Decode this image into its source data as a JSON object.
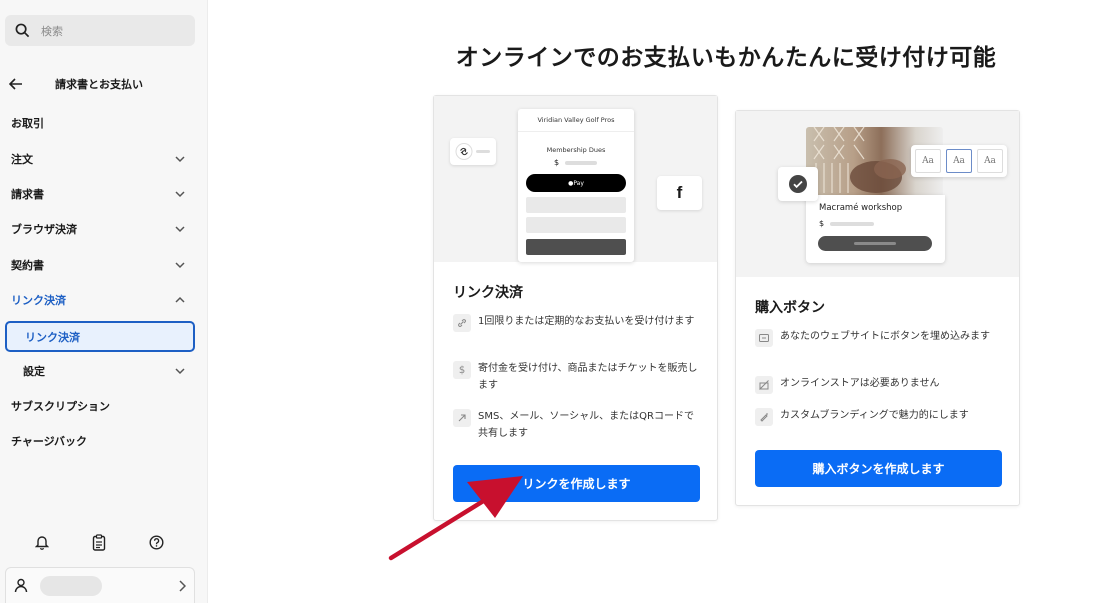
{
  "sidebar": {
    "search_placeholder": "検索",
    "section_title": "請求書とお支払い",
    "items": [
      {
        "label": "お取引"
      },
      {
        "label": "注文"
      },
      {
        "label": "請求書"
      },
      {
        "label": "ブラウザ決済"
      },
      {
        "label": "契約書"
      },
      {
        "label": "リンク決済"
      },
      {
        "label": "リンク決済"
      },
      {
        "label": "設定"
      },
      {
        "label": "サブスクリプション"
      },
      {
        "label": "チャージバック"
      }
    ]
  },
  "main": {
    "title": "オンラインでのお支払いもかんたんに受け付け可能",
    "link_card": {
      "phone_merchant": "Viridian Valley Golf Pros",
      "phone_item": "Membership Dues",
      "phone_currency": "$",
      "phone_pay": " Pay",
      "social_glyph": "f",
      "title": "リンク決済",
      "features": [
        "1回限りまたは定期的なお支払いを受け付けます",
        "寄付金を受け付け、商品またはチケットを販売します",
        "SMS、メール、ソーシャル、またはQRコードで共有します"
      ],
      "cta": "リンクを作成します"
    },
    "button_card": {
      "workshop": "Macramé workshop",
      "currency": "$",
      "font_samples": [
        "Aa",
        "Aa",
        "Aa"
      ],
      "title": "購入ボタン",
      "features": [
        "あなたのウェブサイトにボタンを埋め込みます",
        "オンラインストアは必要ありません",
        "カスタムブランディングで魅力的にします"
      ],
      "cta": "購入ボタンを作成します"
    }
  },
  "colors": {
    "accent": "#0a6cf5",
    "nav_active": "#1d5fc4",
    "annotation_arrow": "#c8102e"
  }
}
